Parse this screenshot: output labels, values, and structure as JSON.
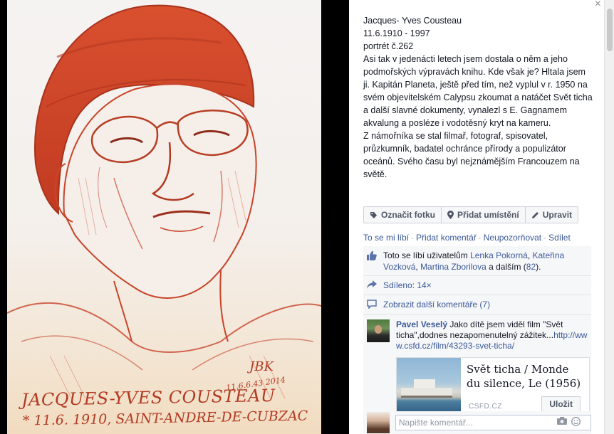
{
  "photo": {
    "signature": "JBK",
    "date_mark": "11.6.6.43 2014",
    "inscription_name": "JACQUES-YVES COUSTEAU",
    "inscription_birth": "* 11.6. 1910, SAINT-ANDRE-DE-CUBZAC"
  },
  "panel": {
    "close_glyph": "×",
    "caption": {
      "line1": "Jacques- Yves Cousteau",
      "line2": "11.6.1910 - 1997",
      "line3": "portrét č.262",
      "paragraph1": "Asi tak v jedenácti letech jsem dostala o něm a jeho podmořských výpravách knihu. Kde však je? Hltala jsem ji. Kapitán Planeta, ještě před tím, než vyplul v r. 1950 na svém objevitelském Calypsu zkoumat a natáčet Svět ticha a další slavné dokumenty, vynalezl s E. Gagnamem akvalung a posléze i vodotěsný kryt na kameru.",
      "paragraph2": "Z námořníka se stal filmař, fotograf, spisovatel, průzkumník, badatel ochránce přírody a populizátor oceánů. Svého času byl nejznámějším Francouzem na světě."
    },
    "actions": {
      "tag": "Označit fotku",
      "location": "Přidat umístění",
      "edit": "Upravit"
    },
    "ufi_links": {
      "like": "To se mi líbí",
      "comment": "Přidat komentář",
      "unfollow": "Neupozorňovat",
      "share": "Sdílet",
      "separator": "·"
    },
    "likes": {
      "prefix": "Toto se líbí uživatelům",
      "user1": "Lenka Pokorná",
      "comma": ",",
      "user2": "Kateřina Vozková",
      "user3": "Martina Zborilova",
      "and_more": "a dalším (",
      "count": "82",
      "suffix": ")."
    },
    "shared": "Sdíleno: 14×",
    "more_comments": "Zobrazit další komentáře (7)",
    "comment": {
      "author": "Pavel Veselý",
      "text": "Jako dítě jsem viděl film \"Svět ticha\",dodnes nezapomenutelný zážitek...",
      "link": "http://www.csfd.cz/film/43293-svet-ticha/",
      "preview_title": "Svět ticha / Monde du silence, Le (1956)",
      "preview_source": "CSFD.CZ",
      "save": "Uložit"
    },
    "composer": {
      "placeholder": "Napište komentář..."
    }
  },
  "colors": {
    "link": "#3b5998",
    "panel_bg": "#ffffff",
    "ufi_bg": "#f6f7f9",
    "sketch_red": "#c8442a"
  },
  "icons": [
    "tag-icon",
    "location-pin-icon",
    "pencil-icon",
    "thumbs-up-icon",
    "share-icon",
    "comment-bubble-icon",
    "camera-icon",
    "smiley-icon",
    "close-icon"
  ]
}
